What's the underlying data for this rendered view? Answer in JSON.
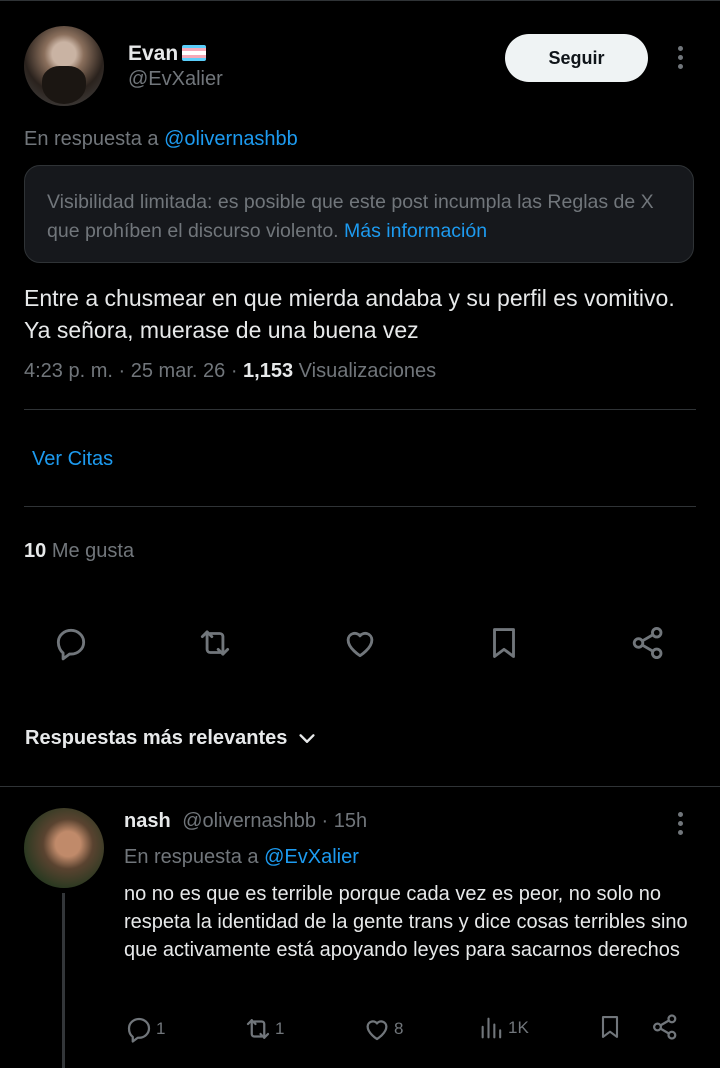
{
  "author": {
    "name": "Evan",
    "handle": "@EvXalier"
  },
  "header": {
    "follow_label": "Seguir"
  },
  "reply_context": {
    "prefix": "En respuesta a",
    "mention": "@olivernashbb"
  },
  "notice": {
    "text": "Visibilidad limitada: es posible que este post incumpla las Reglas de X que prohíben el discurso violento.",
    "link": "Más información"
  },
  "post": {
    "text": "Entre a chusmear en que mierda andaba y su perfil es vomitivo. Ya señora, muerase de una buena vez",
    "time": "4:23 p. m.",
    "sep": "·",
    "date": "25 mar. 26",
    "views_count": "1,153",
    "views_label": "Visualizaciones"
  },
  "quotes_link": "Ver Citas",
  "likes": {
    "count": "10",
    "label": "Me gusta"
  },
  "sort": {
    "label": "Respuestas más relevantes"
  },
  "reply": {
    "name": "nash",
    "handle": "@olivernashbb",
    "time": "· 15h",
    "inreply_prefix": "En respuesta a",
    "inreply_mention": "@EvXalier",
    "text": "no no es que es terrible porque cada vez es peor, no solo no respeta la identidad de la gente trans y dice cosas terribles sino que activamente está apoyando leyes para sacarnos derechos",
    "stats": {
      "replies": "1",
      "reposts": "1",
      "likes": "8",
      "views": "1K"
    }
  },
  "icons": {
    "flag": "transgender-flag",
    "actions": [
      "reply-icon",
      "repost-icon",
      "like-icon",
      "bookmark-icon",
      "share-icon"
    ]
  },
  "colors": {
    "accent": "#1d9bf0",
    "muted": "#71767b",
    "text": "#e7e9ea",
    "border": "#2f3336",
    "background": "#000000"
  }
}
